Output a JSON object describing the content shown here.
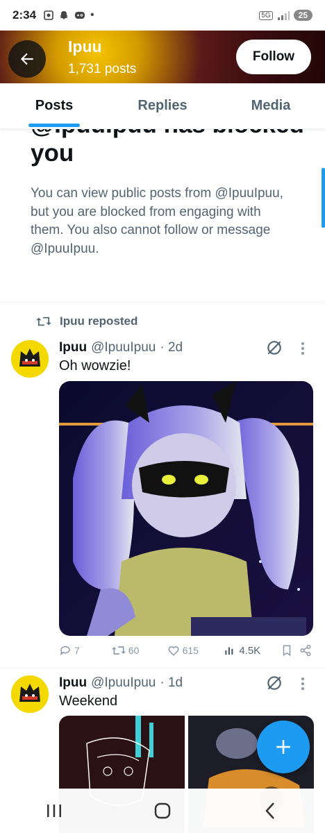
{
  "status_bar": {
    "time": "2:34",
    "network": "5G",
    "battery": "25"
  },
  "header": {
    "name": "Ipuu",
    "post_count": "1,731 posts",
    "follow_label": "Follow"
  },
  "tabs": [
    {
      "label": "Posts"
    },
    {
      "label": "Replies"
    },
    {
      "label": "Media"
    }
  ],
  "blocked": {
    "title": "@IpuuIpuu has blocked you",
    "description": "You can view public posts from @IpuuIpuu, but you are blocked from engaging with them. You also cannot follow or message @IpuuIpuu."
  },
  "repost_label": "Ipuu reposted",
  "tweets": [
    {
      "name": "Ipuu",
      "handle": "@IpuuIpuu",
      "time": "· 2d",
      "text": "Oh wowzie!",
      "stats": {
        "replies": "7",
        "reposts": "60",
        "likes": "615",
        "views": "4.5K"
      }
    },
    {
      "name": "Ipuu",
      "handle": "@IpuuIpuu",
      "time": "· 1d",
      "text": "Weekend"
    }
  ],
  "colors": {
    "accent": "#1d9bf0",
    "text": "#0f1419",
    "secondary": "#536471",
    "avatar_bg": "#f4d900"
  },
  "icons": [
    "back-arrow-icon",
    "repost-icon",
    "grok-icon",
    "more-icon",
    "reply-icon",
    "like-icon",
    "views-icon",
    "bookmark-icon",
    "share-icon",
    "compose-plus-icon",
    "recents-icon",
    "home-icon",
    "nav-back-icon"
  ]
}
